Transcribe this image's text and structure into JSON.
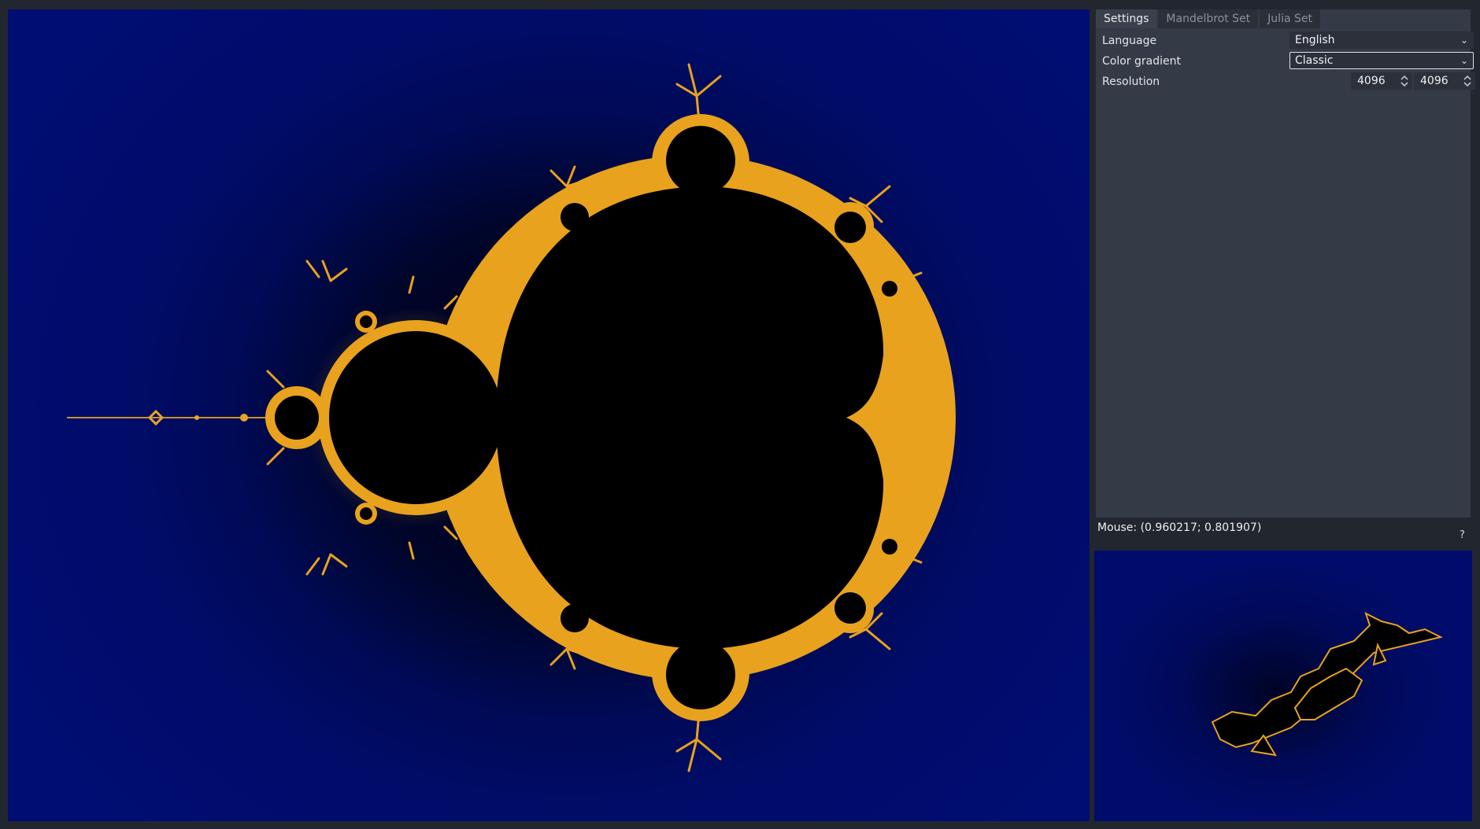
{
  "tabs": [
    {
      "label": "Settings",
      "active": true
    },
    {
      "label": "Mandelbrot Set",
      "active": false
    },
    {
      "label": "Julia Set",
      "active": false
    }
  ],
  "settings": {
    "language": {
      "label": "Language",
      "value": "English"
    },
    "color_gradient": {
      "label": "Color gradient",
      "value": "Classic"
    },
    "resolution": {
      "label": "Resolution",
      "width": "4096",
      "height": "4096"
    }
  },
  "status": {
    "mouse": "Mouse: (0.960217; 0.801907)"
  },
  "help": {
    "label": "?"
  },
  "colors": {
    "background_blue": "#000d72",
    "set_fill": "#000000",
    "boundary_gold": "#e8a21e"
  },
  "icons": {
    "dropdown": "chevron-down-icon",
    "spin": "up-down-arrows-icon"
  }
}
